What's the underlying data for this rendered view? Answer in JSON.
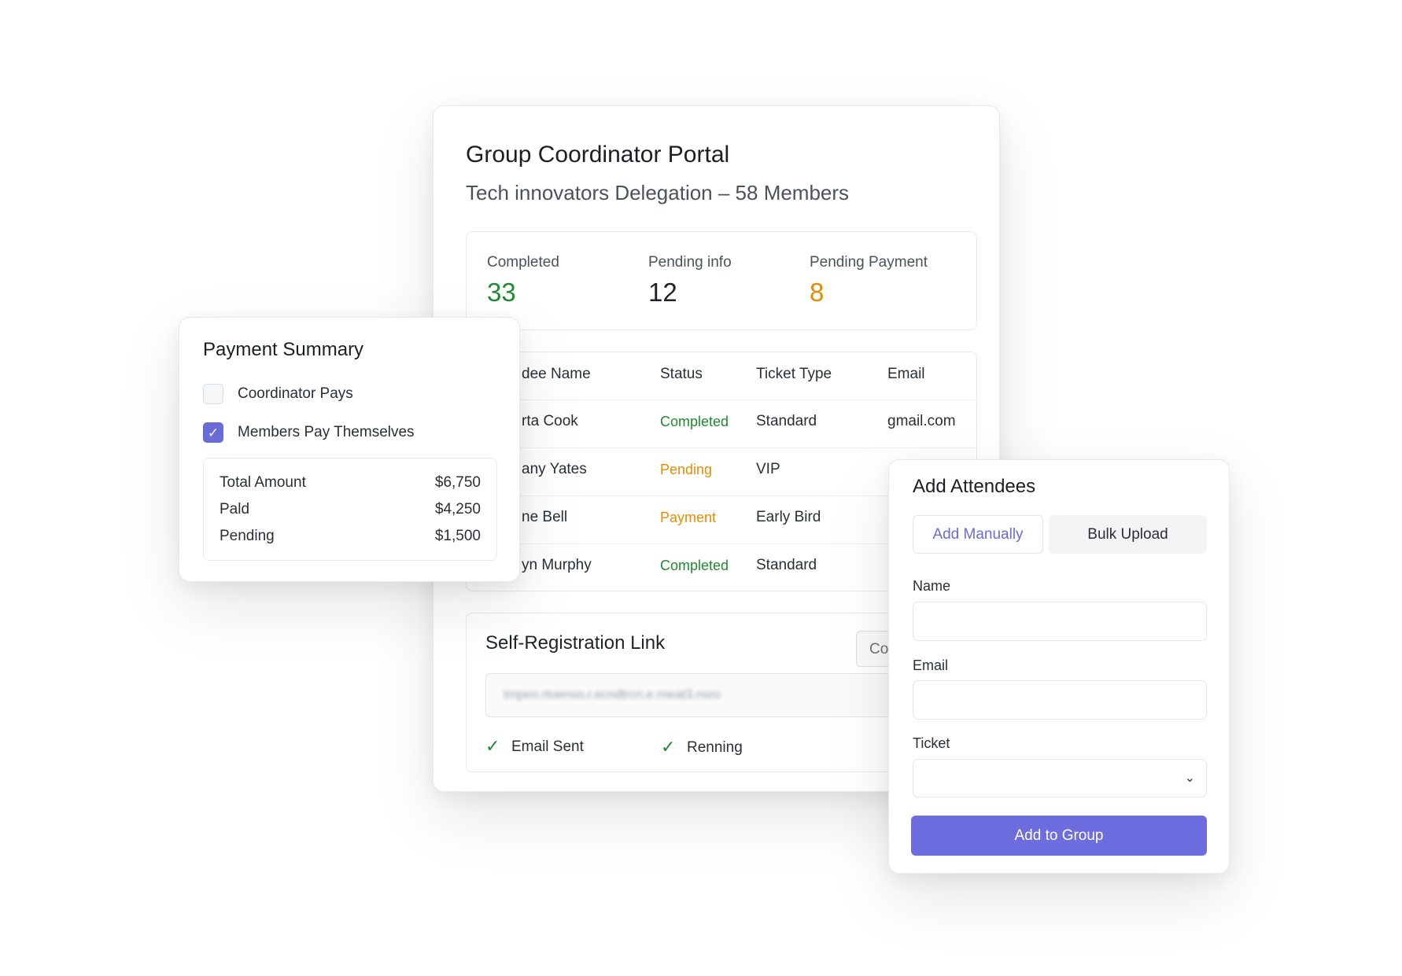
{
  "portal": {
    "title": "Group Coordinator Portal",
    "subtitle": "Tech innovators Delegation – 58 Members",
    "stats": [
      {
        "label": "Completed",
        "value": "33",
        "color": "#1f8a2e"
      },
      {
        "label": "Pending info",
        "value": "12",
        "color": "#1f2329"
      },
      {
        "label": "Pending Payment",
        "value": "8",
        "color": "#e88b00"
      }
    ],
    "table": {
      "headers": [
        "dee Name",
        "Status",
        "Ticket Type",
        "Email"
      ],
      "rows": [
        {
          "name": "rta Cook",
          "status": "Completed",
          "ticket": "Standard",
          "email": "gmail.com"
        },
        {
          "name": "any Yates",
          "status": "Pending",
          "ticket": "VIP",
          "email": ""
        },
        {
          "name": "ne Bell",
          "status": "Payment",
          "ticket": "Early Bird",
          "email": ""
        },
        {
          "name": "yn Murphy",
          "status": "Completed",
          "ticket": "Standard",
          "email": ""
        }
      ]
    },
    "registration": {
      "title": "Self-Registration Link",
      "copy_label": "Co",
      "link_blurred": "tmpeo.rtoenso.r.ecndtrcn.e.rneat3.nsro",
      "checks": [
        {
          "label": "Email Sent",
          "icon": "check-icon"
        },
        {
          "label": "Renning",
          "icon": "check-icon"
        }
      ]
    }
  },
  "payment": {
    "title": "Payment Summary",
    "options": [
      {
        "label": "Coordinator Pays",
        "checked": false
      },
      {
        "label": "Members Pay Themselves",
        "checked": true
      }
    ],
    "summary": [
      {
        "label": "Total Amount",
        "value": "$6,750"
      },
      {
        "label": "Pald",
        "value": "$4,250"
      },
      {
        "label": "Pending",
        "value": "$1,500"
      }
    ]
  },
  "attendees": {
    "title": "Add Attendees",
    "tabs": [
      "Add Manually",
      "Bulk Upload"
    ],
    "fields": {
      "name": "Name",
      "email": "Email",
      "ticket": "Ticket"
    },
    "submit": "Add to Group"
  },
  "colors": {
    "accent": "#6e6de0",
    "success": "#1f8a2e",
    "warning": "#e88b00"
  }
}
